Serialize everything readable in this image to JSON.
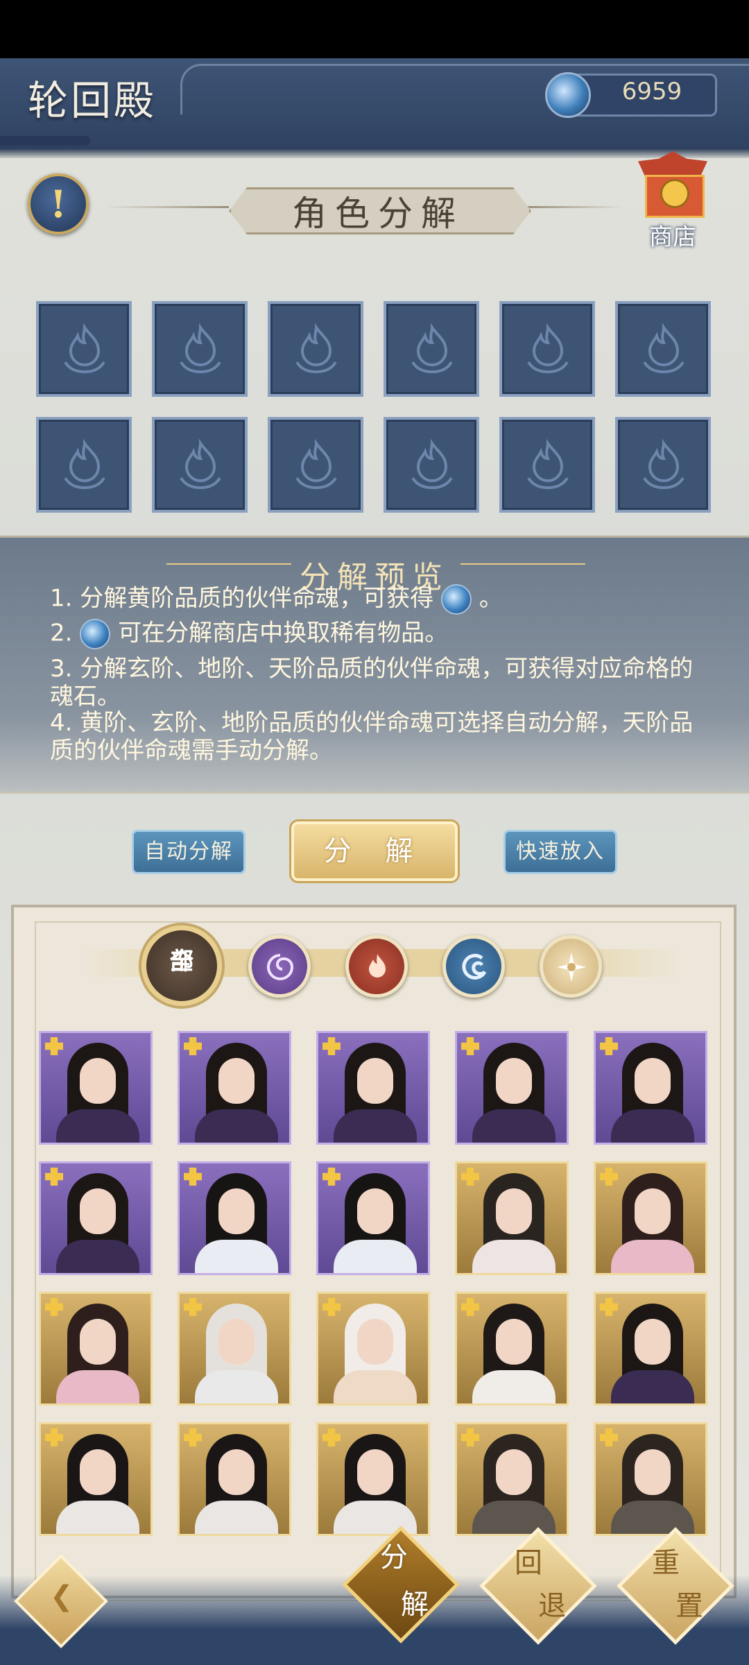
{
  "header": {
    "title": "轮回殿",
    "currency_value": "6959"
  },
  "section_title": "角色分解",
  "shop": {
    "label": "商店"
  },
  "help_mark": "!",
  "preview": {
    "title": "分解预览",
    "line1_a": "1. 分解黄阶品质的伙伴命魂，可获得",
    "line1_b": "。",
    "line2_a": "2.",
    "line2_b": "可在分解商店中换取稀有物品。",
    "line3": "3. 分解玄阶、地阶、天阶品质的伙伴命魂，可获得对应命格的魂石。",
    "line4": "4. 黄阶、玄阶、地阶品质的伙伴命魂可选择自动分解，天阶品质的伙伴命魂需手动分解。"
  },
  "buttons": {
    "auto": "自动分解",
    "decompose": "分 解",
    "quick": "快速放入"
  },
  "filters": {
    "all_1": "全",
    "all_2": "部"
  },
  "bottom": {
    "decompose_1": "分",
    "decompose_2": "解",
    "undo_1": "回",
    "undo_2": "退",
    "reset_1": "重",
    "reset_2": "置"
  },
  "roster": [
    {
      "quality": "purple",
      "look": "girl-dark"
    },
    {
      "quality": "purple",
      "look": "girl-dark"
    },
    {
      "quality": "purple",
      "look": "girl-dark"
    },
    {
      "quality": "purple",
      "look": "girl-dark"
    },
    {
      "quality": "purple",
      "look": "girl-dark"
    },
    {
      "quality": "purple",
      "look": "girl-dark"
    },
    {
      "quality": "purple",
      "look": "man-white"
    },
    {
      "quality": "purple",
      "look": "man-white"
    },
    {
      "quality": "gold",
      "look": "girl-tied"
    },
    {
      "quality": "gold",
      "look": "girl-bow"
    },
    {
      "quality": "gold",
      "look": "girl-bow"
    },
    {
      "quality": "gold",
      "look": "man-silver"
    },
    {
      "quality": "gold",
      "look": "girl-white"
    },
    {
      "quality": "gold",
      "look": "girl-bunny"
    },
    {
      "quality": "gold",
      "look": "girl-dark"
    },
    {
      "quality": "gold",
      "look": "girl-bangs"
    },
    {
      "quality": "gold",
      "look": "girl-bangs"
    },
    {
      "quality": "gold",
      "look": "girl-bangs"
    },
    {
      "quality": "gold",
      "look": "man-beard"
    },
    {
      "quality": "gold",
      "look": "man-beard"
    }
  ]
}
